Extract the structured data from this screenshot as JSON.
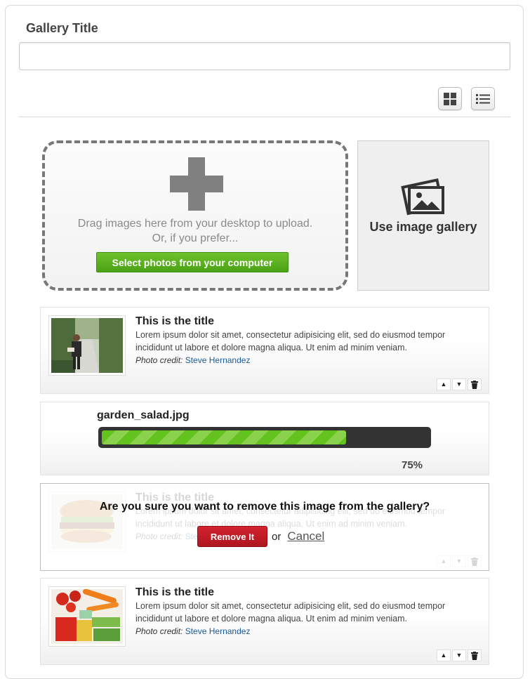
{
  "header": {
    "gallery_title_label": "Gallery Title",
    "gallery_title_value": ""
  },
  "view_toggle": {
    "grid_icon": "grid-icon",
    "list_icon": "list-icon"
  },
  "upload": {
    "plus_icon": "plus-icon",
    "drag_text": "Drag images here from your desktop to upload.",
    "or_text": "Or, if you prefer...",
    "select_button_label": "Select photos from your computer",
    "use_gallery_label": "Use image gallery",
    "gallery_icon": "photos-icon"
  },
  "items": [
    {
      "title": "This is the title",
      "description": "Lorem ipsum dolor sit amet, consectetur adipisicing elit, sed do eiusmod tempor incididunt ut labore et dolore magna aliqua. Ut enim ad minim veniam.",
      "credit_label": "Photo credit:",
      "credit_name": "Steve Hernandez",
      "thumbnail": "man-in-garden-photo"
    },
    {
      "title": "This is the title",
      "description": "Lorem ipsum dolor sit amet, consectetur adipisicing elit, sed do eiusmod tempor incididunt ut labore et dolore magna aliqua. Ut enim ad minim veniam.",
      "credit_label": "Photo credit:",
      "credit_name": "Steve Hernandez",
      "thumbnail": "sandwich-photo"
    },
    {
      "title": "This is the title",
      "description": "Lorem ipsum dolor sit amet, consectetur adipisicing elit, sed do eiusmod tempor incididunt ut labore et dolore magna aliqua. Ut enim ad minim veniam.",
      "credit_label": "Photo credit:",
      "credit_name": "Steve Hernandez",
      "thumbnail": "vegetables-photo"
    }
  ],
  "uploading": {
    "filename": "garden_salad.jpg",
    "progress_percent": 75,
    "progress_label": "75%"
  },
  "remove_confirm": {
    "question": "Are you sure you want to remove this image from the gallery?",
    "remove_label": "Remove It",
    "or_label": "or",
    "cancel_label": "Cancel"
  },
  "item_actions": {
    "move_up": "▲",
    "move_down": "▼",
    "delete_icon": "trash-icon"
  },
  "colors": {
    "select_button": "#4aa215",
    "remove_button": "#c01c26",
    "progress_fill": "#64c21f",
    "credit_link": "#1c5a9a"
  }
}
